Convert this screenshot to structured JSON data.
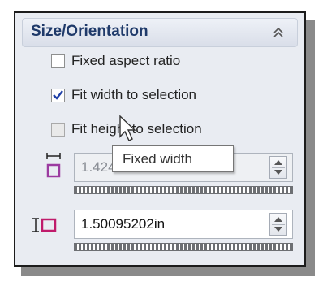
{
  "section": {
    "title": "Size/Orientation",
    "collapse_icon": "double-chevron-up-icon"
  },
  "options": [
    {
      "label": "Fixed aspect ratio",
      "checked": false,
      "enabled": true
    },
    {
      "label": "Fit width to selection",
      "checked": true,
      "enabled": true
    },
    {
      "label": "Fit height to selection",
      "checked": false,
      "enabled": false
    }
  ],
  "width_field": {
    "value": "1.42499995in",
    "icon": "fixed-width-icon",
    "enabled": false
  },
  "height_field": {
    "value": "1.50095202in",
    "icon": "height-icon",
    "enabled": true
  },
  "tooltip": {
    "text": "Fixed width"
  },
  "colors": {
    "panel_bg": "#e9ecf2",
    "header_text": "#1f3a6a",
    "checkmark": "#1f3fa8",
    "width_icon": "#9b3aa0",
    "height_icon": "#c01b6b"
  }
}
